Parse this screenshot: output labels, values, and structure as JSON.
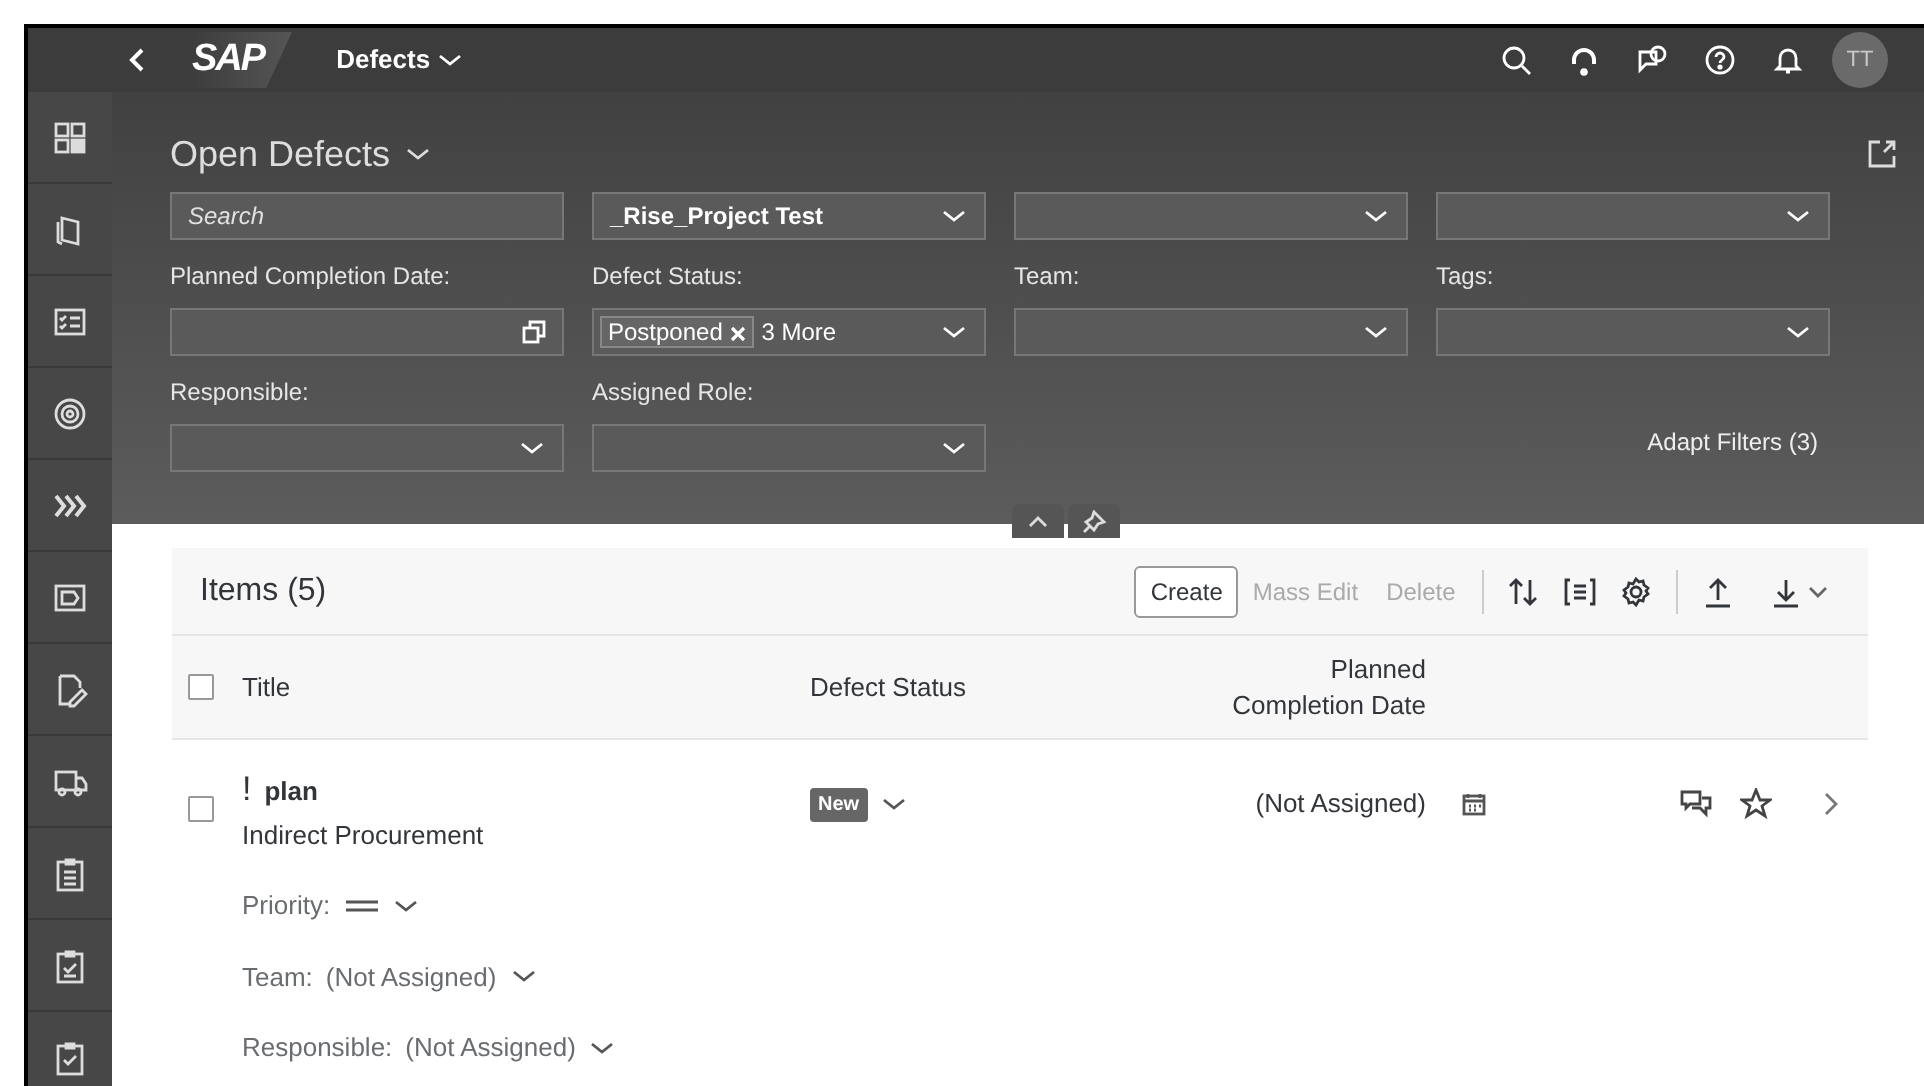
{
  "shell": {
    "logo": "SAP",
    "app_title": "Defects",
    "avatar": "TT"
  },
  "variant": {
    "title": "Open Defects"
  },
  "filters": [
    {
      "kind": "search",
      "placeholder": "Search"
    },
    {
      "kind": "select",
      "value": "_Rise_Project Test"
    },
    {
      "kind": "select"
    },
    {
      "kind": "select"
    },
    {
      "kind": "date",
      "label": "Planned Completion Date:"
    },
    {
      "kind": "multi",
      "label": "Defect Status:",
      "tokens": [
        "Postponed"
      ],
      "more": "3 More"
    },
    {
      "kind": "select",
      "label": "Team:"
    },
    {
      "kind": "select",
      "label": "Tags:"
    },
    {
      "kind": "select",
      "label": "Responsible:"
    },
    {
      "kind": "select",
      "label": "Assigned Role:"
    }
  ],
  "adapt_filters": "Adapt Filters (3)",
  "table": {
    "title": "Items (5)",
    "actions": [
      {
        "label": "Create",
        "disabled": false
      },
      {
        "label": "Mass Edit",
        "disabled": true
      },
      {
        "label": "Delete",
        "disabled": true
      }
    ],
    "columns": [
      "Title",
      "Defect Status",
      "Planned Completion Date"
    ],
    "select_all_checked": false,
    "rows": [
      {
        "checked": false,
        "priority_mark": "!",
        "title": "plan",
        "subtitle": "Indirect Procurement",
        "status": "New",
        "date": "(Not Assigned)",
        "details": [
          {
            "kind": "priority",
            "label": "Priority:"
          },
          {
            "kind": "value",
            "label": "Team:",
            "value": "(Not Assigned)"
          },
          {
            "kind": "value",
            "label": "Responsible:",
            "value": "(Not Assigned)"
          }
        ]
      }
    ]
  }
}
